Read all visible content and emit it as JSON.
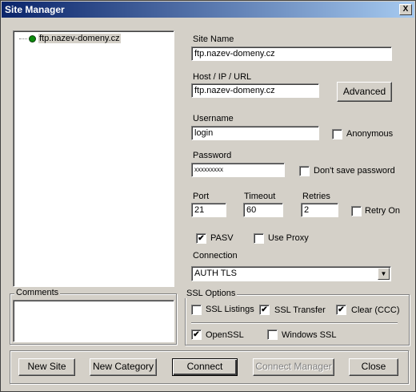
{
  "window": {
    "title": "Site Manager",
    "close_glyph": "X"
  },
  "tree": {
    "items": [
      {
        "label": "ftp.nazev-domeny.cz",
        "icon": "server-icon"
      }
    ]
  },
  "comments": {
    "label": "Comments",
    "value": ""
  },
  "site_name": {
    "label": "Site Name",
    "value": "ftp.nazev-domeny.cz"
  },
  "host": {
    "label": "Host / IP / URL",
    "value": "ftp.nazev-domeny.cz",
    "advanced_label": "Advanced"
  },
  "username": {
    "label": "Username",
    "value": "login",
    "anonymous_label": "Anonymous",
    "anonymous_checked": false
  },
  "password": {
    "label": "Password",
    "value": "xxxxxxxxx",
    "dont_save_label": "Don't save password",
    "dont_save_checked": false
  },
  "port": {
    "label": "Port",
    "value": "21"
  },
  "timeout": {
    "label": "Timeout",
    "value": "60"
  },
  "retries": {
    "label": "Retries",
    "value": "2"
  },
  "retry_on": {
    "label": "Retry On",
    "checked": false
  },
  "pasv": {
    "label": "PASV",
    "checked": true
  },
  "use_proxy": {
    "label": "Use Proxy",
    "checked": false
  },
  "connection": {
    "label": "Connection",
    "value": "AUTH TLS"
  },
  "ssl": {
    "group_label": "SSL Options",
    "listings": {
      "label": "SSL Listings",
      "checked": false
    },
    "transfer": {
      "label": "SSL Transfer",
      "checked": true
    },
    "clear_ccc": {
      "label": "Clear (CCC)",
      "checked": true
    },
    "openssl": {
      "label": "OpenSSL",
      "checked": true
    },
    "windows_ssl": {
      "label": "Windows SSL",
      "checked": false
    }
  },
  "buttons": {
    "new_site": "New Site",
    "new_category": "New Category",
    "connect": "Connect",
    "connect_manager": "Connect Manager",
    "close": "Close"
  },
  "check_glyph": "✔"
}
